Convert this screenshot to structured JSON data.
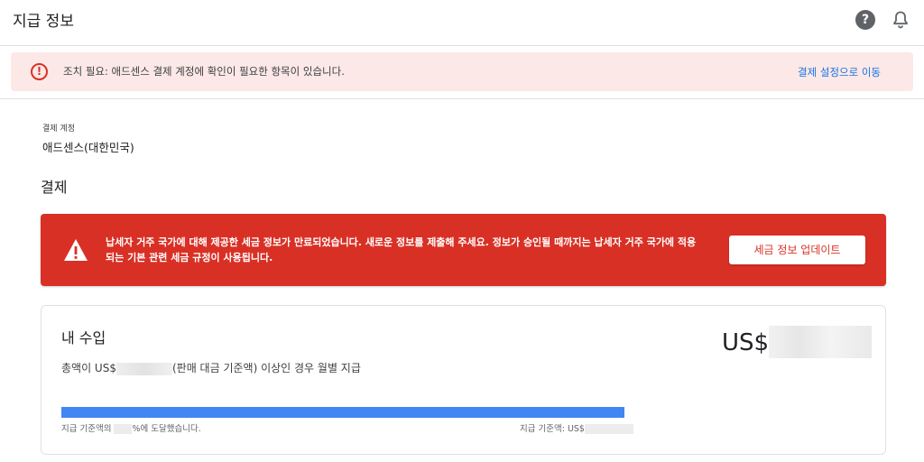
{
  "header": {
    "title": "지급 정보",
    "help_glyph": "?",
    "help_icon": "help-icon",
    "bell_icon": "bell-icon"
  },
  "action_banner": {
    "icon_glyph": "!",
    "message": "조치 필요: 애드센스 결제 계정에 확인이 필요한 항목이 있습니다.",
    "link": "결제 설정으로 이동",
    "bg_color": "#fce8e6",
    "accent_color": "#d93025"
  },
  "account": {
    "label": "결제 계정",
    "value": "애드센스(대한민국)"
  },
  "payments": {
    "title": "결제"
  },
  "tax_banner": {
    "message": "납세자 거주 국가에 대해 제공한 세금 정보가 만료되었습니다. 새로운 정보를 제출해 주세요. 정보가 승인될 때까지는 납세자 거주 국가에 적용되는 기본 관련 세금 규정이 사용됩니다.",
    "button": "세금 정보 업데이트",
    "bg_color": "#d93025"
  },
  "earnings": {
    "title": "내 수입",
    "amount_prefix": "US$",
    "desc_prefix": "총액이 US$",
    "desc_suffix": "(판매 대금 기준액) 이상인 경우 월별 지급",
    "progress_percent": 100,
    "progress_color": "#4285f4",
    "progress_left_prefix": "지급 기준액의 ",
    "progress_left_suffix": "%에 도달했습니다.",
    "progress_right_prefix": "지급 기준액: US$"
  }
}
